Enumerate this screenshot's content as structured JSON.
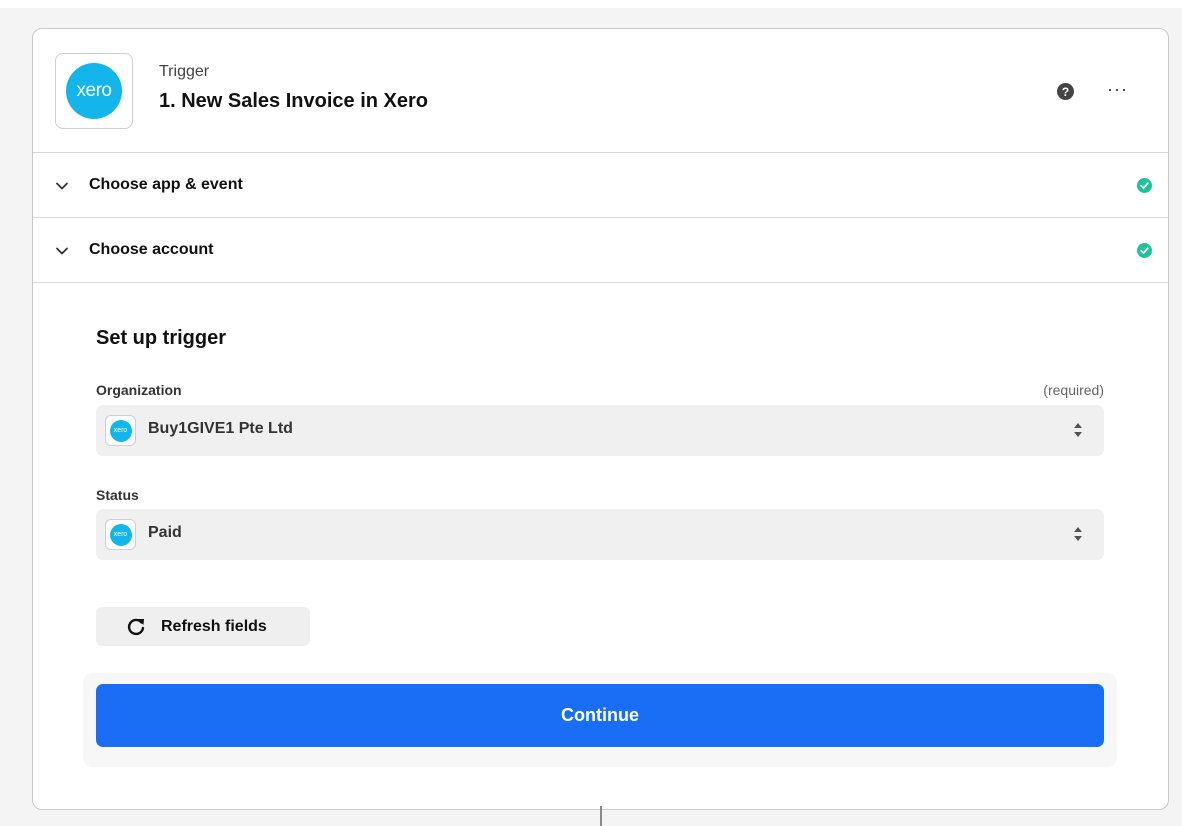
{
  "step": {
    "app_logo_text": "xero",
    "label": "Trigger",
    "title": "1. New Sales Invoice in Xero"
  },
  "sections": [
    {
      "label": "Choose app & event"
    },
    {
      "label": "Choose account"
    }
  ],
  "setup": {
    "title": "Set up trigger",
    "organization": {
      "label": "Organization",
      "required_text": "(required)",
      "value": "Buy1GIVE1 Pte Ltd"
    },
    "status": {
      "label": "Status",
      "value": "Paid"
    },
    "refresh_label": "Refresh fields",
    "continue_label": "Continue"
  },
  "colors": {
    "xero_brand": "#13b5ea",
    "continue_blue": "#1a6ef5",
    "check_green": "#1fc29b"
  },
  "icons": {
    "help": "help-icon",
    "more": "more-icon",
    "chevron": "chevron-down-icon",
    "complete": "check-circle-icon",
    "refresh": "refresh-icon",
    "select": "updown-icon"
  }
}
